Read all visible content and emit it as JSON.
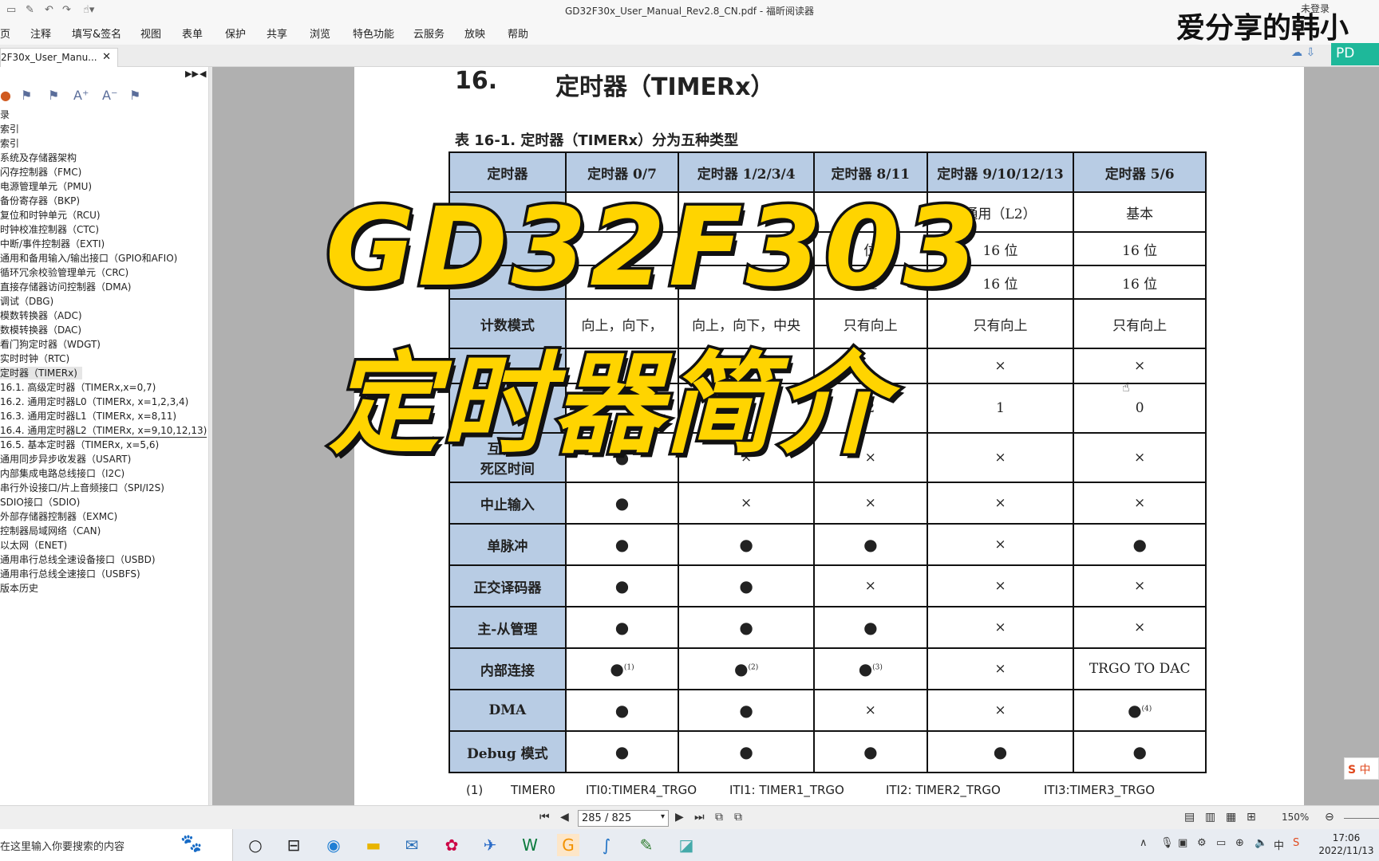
{
  "app": {
    "window_title": "GD32F30x_User_Manual_Rev2.8_CN.pdf - 福昕阅读器",
    "login_label": "未登录",
    "watermark": "爱分享的韩小",
    "pd_label": "PD"
  },
  "menu": [
    "页",
    "注释",
    "填写&签名",
    "视图",
    "表单",
    "保护",
    "共享",
    "浏览",
    "特色功能",
    "云服务",
    "放映",
    "帮助"
  ],
  "tab": {
    "label": "2F30x_User_Manu...",
    "close": "✕"
  },
  "sidebar": {
    "bookmarks": [
      "录",
      "索引",
      "索引",
      "系统及存储器架构",
      "闪存控制器（FMC)",
      "电源管理单元（PMU)",
      "备份寄存器（BKP)",
      "复位和时钟单元（RCU)",
      "时钟校准控制器（CTC)",
      "中断/事件控制器（EXTI)",
      "通用和备用输入/输出接口（GPIO和AFIO)",
      "循环冗余校验管理单元（CRC)",
      "直接存储器访问控制器（DMA)",
      "调试（DBG)",
      "模数转换器（ADC)",
      "数模转换器（DAC)",
      "看门狗定时器（WDGT)",
      "实时时钟（RTC)",
      "定时器（TIMERx)",
      "16.1. 高级定时器（TIMERx,x=0,7)",
      "16.2. 通用定时器L0（TIMERx, x=1,2,3,4)",
      "16.3. 通用定时器L1（TIMERx, x=8,11)",
      "16.4. 通用定时器L2（TIMERx, x=9,10,12,13)",
      "16.5. 基本定时器（TIMERx, x=5,6)",
      "通用同步异步收发器（USART)",
      "内部集成电路总线接口（I2C)",
      "串行外设接口/片上音频接口（SPI/I2S)",
      "SDIO接口（SDIO)",
      "外部存储器控制器（EXMC)",
      "控制器局域网络（CAN)",
      "以太网（ENET)",
      "通用串行总线全速设备接口（USBD)",
      "通用串行总线全速接口（USBFS)",
      "版本历史"
    ]
  },
  "document": {
    "section_number": "16.",
    "section_title": "定时器（TIMERx）",
    "table_caption": "表 16-1. 定时器（TIMERx）分为五种类型",
    "table": {
      "headers": [
        "定时器",
        "定时器 0/7",
        "定时器 1/2/3/4",
        "定时器 8/11",
        "定时器 9/10/12/13",
        "定时器 5/6"
      ],
      "rows": [
        [
          "",
          "",
          "",
          "）",
          "通用（L2）",
          "基本"
        ],
        [
          "",
          "",
          "",
          "位",
          "16 位",
          "16 位"
        ],
        [
          "",
          "",
          "",
          "位",
          "16 位",
          "16 位"
        ],
        [
          "计数模式",
          "向上，向下，",
          "向上，向下，中央",
          "只有向上",
          "只有向上",
          "只有向上"
        ],
        [
          "",
          "",
          "",
          "",
          "×",
          "×"
        ],
        [
          "",
          "",
          "",
          "2",
          "1",
          "0"
        ],
        [
          "互补和\n死区时间",
          "●",
          "×",
          "×",
          "×",
          "×"
        ],
        [
          "中止输入",
          "●",
          "×",
          "×",
          "×",
          "×"
        ],
        [
          "单脉冲",
          "●",
          "●",
          "●",
          "×",
          "●"
        ],
        [
          "正交译码器",
          "●",
          "●",
          "×",
          "×",
          "×"
        ],
        [
          "主-从管理",
          "●",
          "●",
          "●",
          "×",
          "×"
        ],
        [
          "内部连接",
          "●(1)",
          "●(2)",
          "●(3)",
          "×",
          "TRGO TO DAC"
        ],
        [
          "DMA",
          "●",
          "●",
          "×",
          "×",
          "●(4)"
        ],
        [
          "Debug 模式",
          "●",
          "●",
          "●",
          "●",
          "●"
        ]
      ]
    },
    "footnote": {
      "num": "(1)",
      "timer": "TIMER0",
      "iti0": "ITI0:TIMER4_TRGO",
      "iti1": "ITI1: TIMER1_TRGO",
      "iti2": "ITI2: TIMER2_TRGO",
      "iti3": "ITI3:TIMER3_TRGO"
    }
  },
  "overlay": {
    "line1": "GD32F303",
    "line2": "定时器简介"
  },
  "statusbar": {
    "page_value": "285 / 825",
    "zoom": "150%"
  },
  "taskbar": {
    "search_placeholder": "在这里输入你要搜索的内容",
    "time": "17:06",
    "date": "2022/11/13"
  },
  "ime": {
    "label": "中"
  }
}
